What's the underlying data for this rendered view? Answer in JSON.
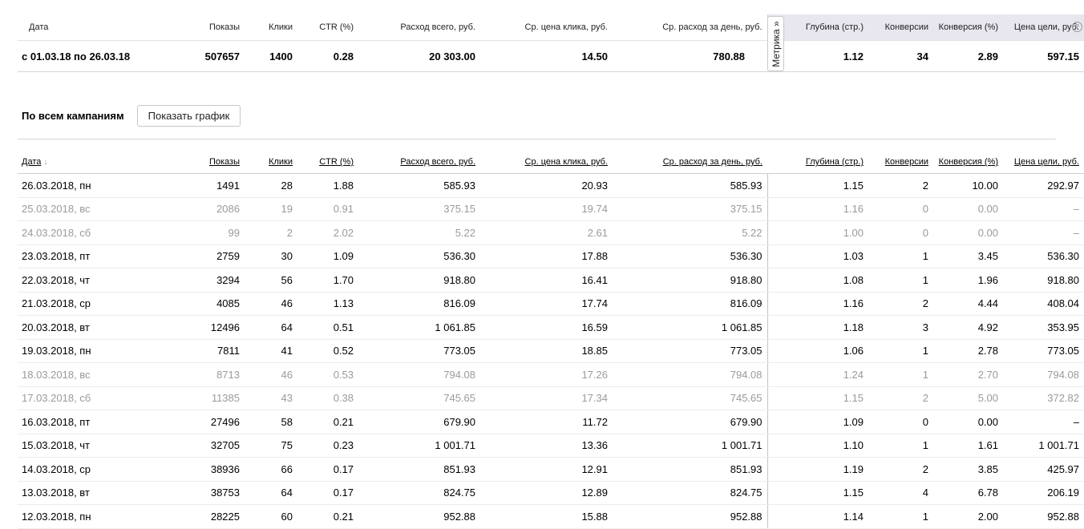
{
  "columns": [
    {
      "label": "Дата",
      "align": "lft"
    },
    {
      "label": "Показы",
      "align": "num"
    },
    {
      "label": "Клики",
      "align": "num"
    },
    {
      "label": "CTR (%)",
      "align": "num"
    },
    {
      "label": "Расход всего, руб.",
      "align": "num"
    },
    {
      "label": "Ср. цена клика, руб.",
      "align": "num"
    },
    {
      "label": "Ср. расход за день, руб.",
      "align": "num"
    },
    {
      "label": "Глубина (стр.)",
      "align": "num"
    },
    {
      "label": "Конверсии",
      "align": "num"
    },
    {
      "label": "Конверсия (%)",
      "align": "num"
    },
    {
      "label": "Цена цели, руб.",
      "align": "num"
    }
  ],
  "summary": {
    "cells": [
      "с 01.03.18 по 26.03.18",
      "507657",
      "1400",
      "0.28",
      "20 303.00",
      "14.50",
      "780.88",
      "1.12",
      "34",
      "2.89",
      "597.15"
    ],
    "help_icon": "?",
    "metrika_tab": "Метрика »"
  },
  "campaigns": {
    "heading": "По всем кампаниям",
    "chart_button": "Показать график"
  },
  "table": {
    "sort_arrow": "↓",
    "rows": [
      {
        "weekend": false,
        "cells": [
          "26.03.2018, пн",
          "1491",
          "28",
          "1.88",
          "585.93",
          "20.93",
          "585.93",
          "1.15",
          "2",
          "10.00",
          "292.97"
        ]
      },
      {
        "weekend": true,
        "cells": [
          "25.03.2018, вс",
          "2086",
          "19",
          "0.91",
          "375.15",
          "19.74",
          "375.15",
          "1.16",
          "0",
          "0.00",
          "–"
        ]
      },
      {
        "weekend": true,
        "cells": [
          "24.03.2018, сб",
          "99",
          "2",
          "2.02",
          "5.22",
          "2.61",
          "5.22",
          "1.00",
          "0",
          "0.00",
          "–"
        ]
      },
      {
        "weekend": false,
        "cells": [
          "23.03.2018, пт",
          "2759",
          "30",
          "1.09",
          "536.30",
          "17.88",
          "536.30",
          "1.03",
          "1",
          "3.45",
          "536.30"
        ]
      },
      {
        "weekend": false,
        "cells": [
          "22.03.2018, чт",
          "3294",
          "56",
          "1.70",
          "918.80",
          "16.41",
          "918.80",
          "1.08",
          "1",
          "1.96",
          "918.80"
        ]
      },
      {
        "weekend": false,
        "cells": [
          "21.03.2018, ср",
          "4085",
          "46",
          "1.13",
          "816.09",
          "17.74",
          "816.09",
          "1.16",
          "2",
          "4.44",
          "408.04"
        ]
      },
      {
        "weekend": false,
        "cells": [
          "20.03.2018, вт",
          "12496",
          "64",
          "0.51",
          "1 061.85",
          "16.59",
          "1 061.85",
          "1.18",
          "3",
          "4.92",
          "353.95"
        ]
      },
      {
        "weekend": false,
        "cells": [
          "19.03.2018, пн",
          "7811",
          "41",
          "0.52",
          "773.05",
          "18.85",
          "773.05",
          "1.06",
          "1",
          "2.78",
          "773.05"
        ]
      },
      {
        "weekend": true,
        "cells": [
          "18.03.2018, вс",
          "8713",
          "46",
          "0.53",
          "794.08",
          "17.26",
          "794.08",
          "1.24",
          "1",
          "2.70",
          "794.08"
        ]
      },
      {
        "weekend": true,
        "cells": [
          "17.03.2018, сб",
          "11385",
          "43",
          "0.38",
          "745.65",
          "17.34",
          "745.65",
          "1.15",
          "2",
          "5.00",
          "372.82"
        ]
      },
      {
        "weekend": false,
        "cells": [
          "16.03.2018, пт",
          "27496",
          "58",
          "0.21",
          "679.90",
          "11.72",
          "679.90",
          "1.09",
          "0",
          "0.00",
          "–"
        ]
      },
      {
        "weekend": false,
        "cells": [
          "15.03.2018, чт",
          "32705",
          "75",
          "0.23",
          "1 001.71",
          "13.36",
          "1 001.71",
          "1.10",
          "1",
          "1.61",
          "1 001.71"
        ]
      },
      {
        "weekend": false,
        "cells": [
          "14.03.2018, ср",
          "38936",
          "66",
          "0.17",
          "851.93",
          "12.91",
          "851.93",
          "1.19",
          "2",
          "3.85",
          "425.97"
        ]
      },
      {
        "weekend": false,
        "cells": [
          "13.03.2018, вт",
          "38753",
          "64",
          "0.17",
          "824.75",
          "12.89",
          "824.75",
          "1.15",
          "4",
          "6.78",
          "206.19"
        ]
      },
      {
        "weekend": false,
        "cells": [
          "12.03.2018, пн",
          "28225",
          "60",
          "0.21",
          "952.88",
          "15.88",
          "952.88",
          "1.14",
          "1",
          "2.00",
          "952.88"
        ]
      }
    ]
  }
}
